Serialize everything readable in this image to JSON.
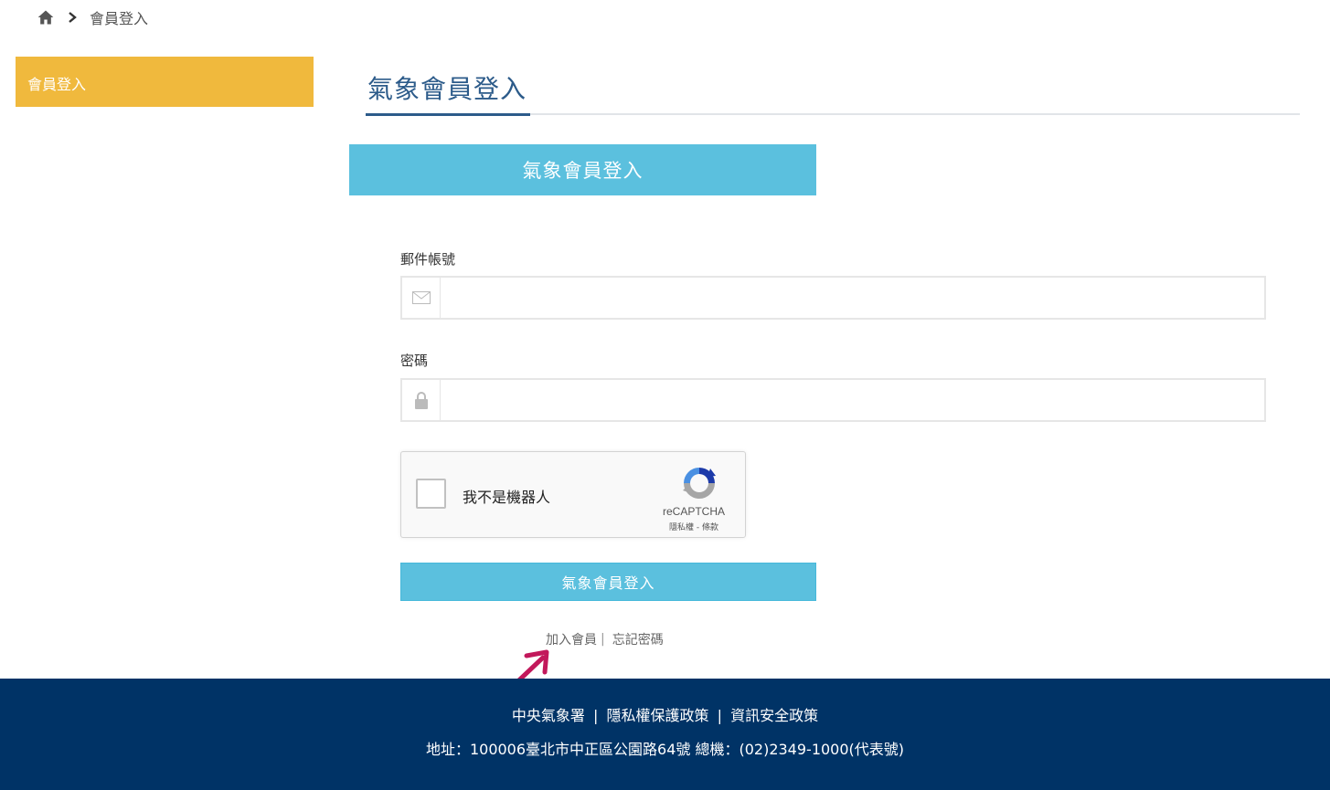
{
  "breadcrumb": {
    "home_icon": "home-icon",
    "separator_icon": "chevron-right-icon",
    "current": "會員登入"
  },
  "sidebar": {
    "items": [
      {
        "label": "會員登入",
        "active": true
      }
    ],
    "accent_color": "#f0b93d"
  },
  "main": {
    "title": "氣象會員登入",
    "banner": "氣象會員登入",
    "email_label": "郵件帳號",
    "email_icon": "envelope-icon",
    "email_value": "",
    "password_label": "密碼",
    "password_icon": "lock-icon",
    "password_value": "",
    "captcha": {
      "checkbox_label": "我不是機器人",
      "brand": "reCAPTCHA",
      "terms": "隱私權 - 條款",
      "checked": false
    },
    "submit_label": "氣象會員登入",
    "links": {
      "join": "加入會員",
      "separator": "|",
      "forgot": "忘記密碼"
    }
  },
  "footer": {
    "links": [
      "中央氣象署",
      "隱私權保護政策",
      "資訊安全政策"
    ],
    "separator": "|",
    "address": "地址：100006臺北市中正區公園路64號 總機：(02)2349-1000(代表號)",
    "background": "#003366"
  },
  "theme": {
    "primary_button": "#5bc0de",
    "title_color": "#2c5b8a",
    "annotation_arrow": "#c2185b"
  }
}
